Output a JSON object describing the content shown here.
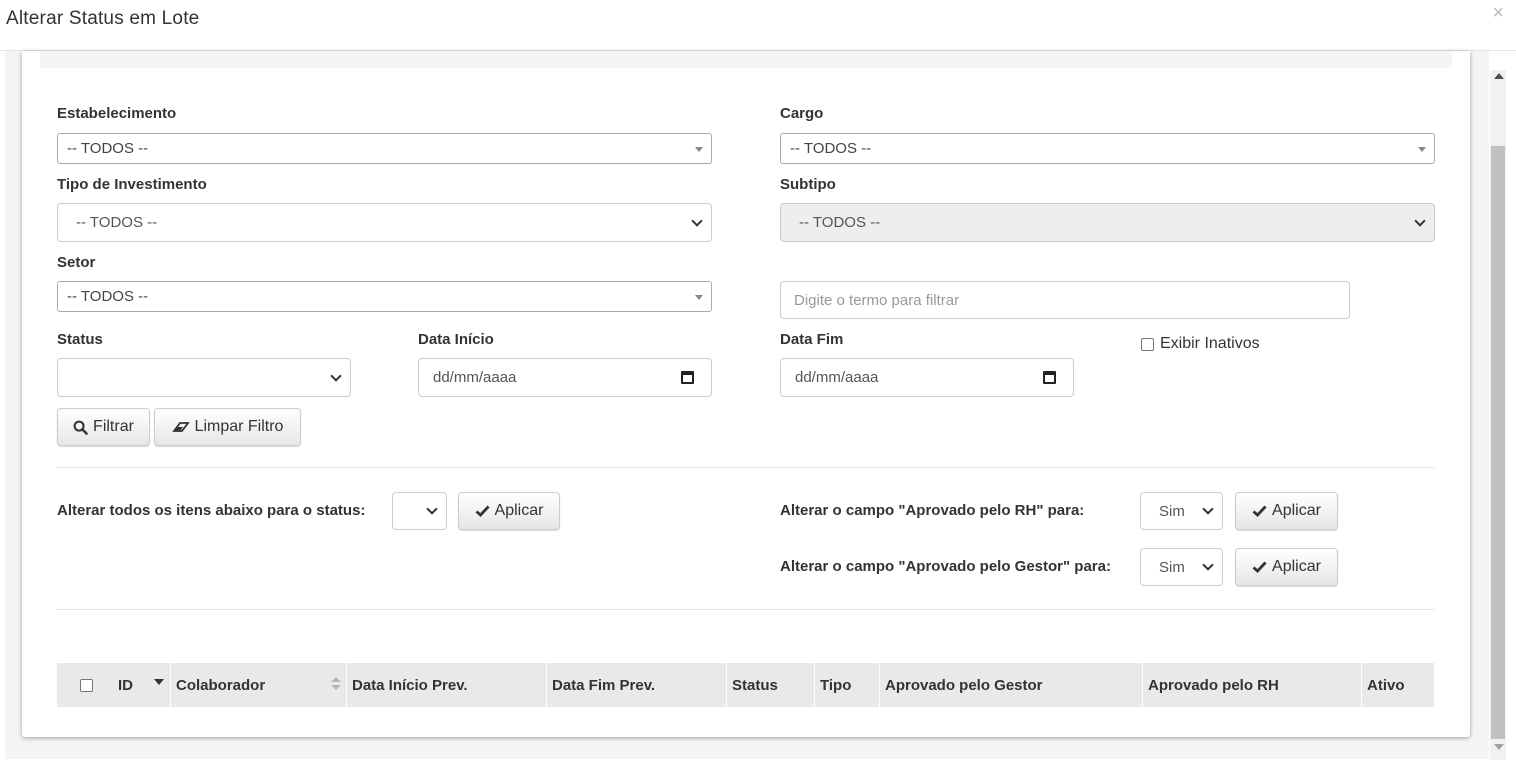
{
  "modal": {
    "title": "Alterar Status em Lote",
    "close_symbol": "×"
  },
  "filters": {
    "estabelecimento": {
      "label": "Estabelecimento",
      "value": "-- TODOS --"
    },
    "cargo": {
      "label": "Cargo",
      "value": "-- TODOS --"
    },
    "tipo_investimento": {
      "label": "Tipo de Investimento",
      "value": "-- TODOS --"
    },
    "subtipo": {
      "label": "Subtipo",
      "value": "-- TODOS --"
    },
    "setor": {
      "label": "Setor",
      "value": "-- TODOS --"
    },
    "search": {
      "placeholder": "Digite o termo para filtrar"
    },
    "status": {
      "label": "Status",
      "value": ""
    },
    "data_inicio": {
      "label": "Data Início",
      "placeholder": "dd/mm/aaaa"
    },
    "data_fim": {
      "label": "Data Fim",
      "placeholder": "dd/mm/aaaa"
    },
    "exibir_inativos": {
      "label": "Exibir Inativos",
      "checked": false
    },
    "filter_button": "Filtrar",
    "clear_button": "Limpar Filtro"
  },
  "bulk": {
    "status_label": "Alterar todos os itens abaixo para o status:",
    "status_value": "",
    "rh_label": "Alterar o campo \"Aprovado pelo RH\" para:",
    "rh_value": "Sim",
    "gestor_label": "Alterar o campo \"Aprovado pelo Gestor\" para:",
    "gestor_value": "Sim",
    "apply_label": "Aplicar"
  },
  "table": {
    "columns": [
      "ID",
      "Colaborador",
      "Data Início Prev.",
      "Data Fim Prev.",
      "Status",
      "Tipo",
      "Aprovado pelo Gestor",
      "Aprovado pelo RH",
      "Ativo"
    ]
  },
  "icons": {
    "search": "search-icon",
    "eraser": "eraser-icon",
    "check": "check-icon",
    "calendar": "calendar-icon"
  }
}
